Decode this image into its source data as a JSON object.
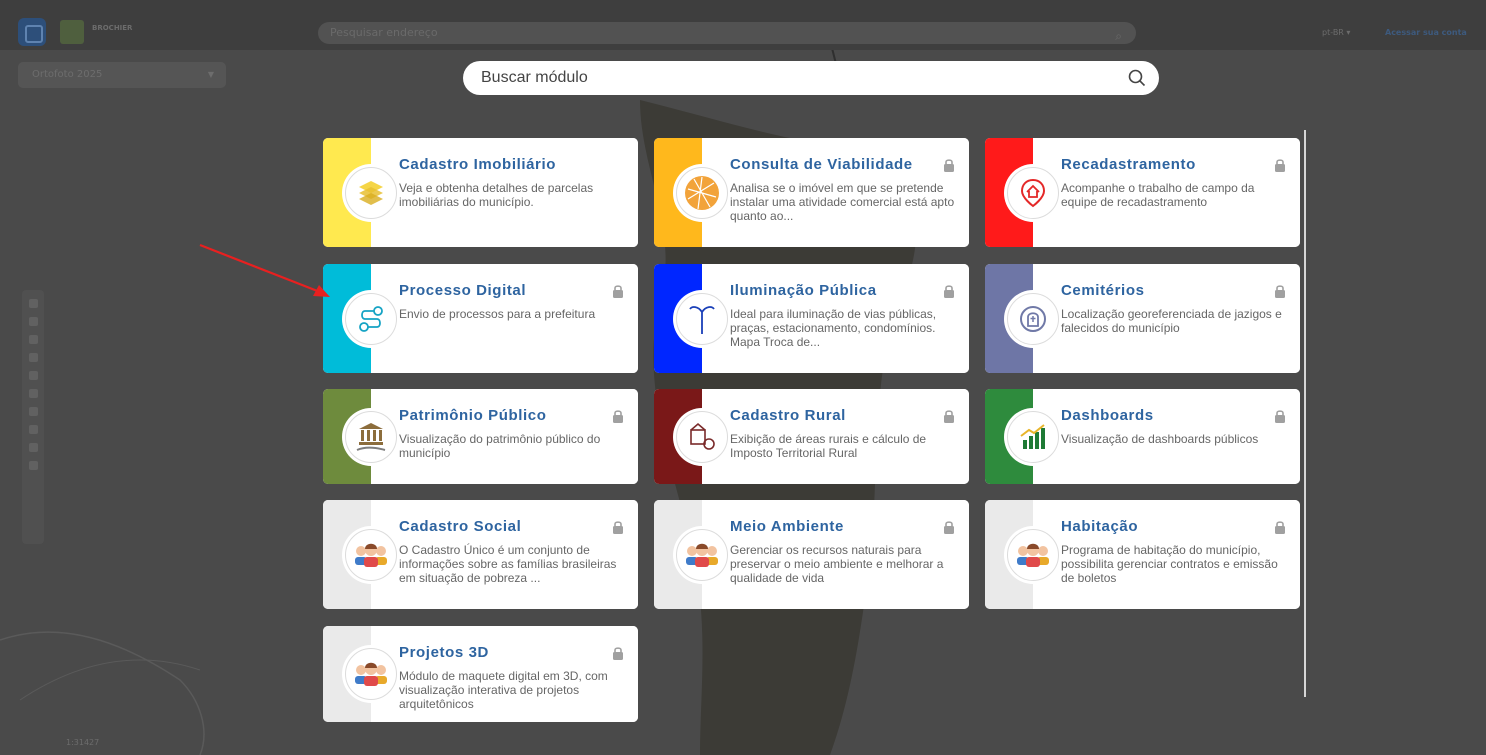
{
  "topbar": {
    "city_name": "BROCHIER",
    "search_placeholder": "Pesquisar endereço",
    "language": "pt-BR ▾",
    "login": "Acessar sua conta"
  },
  "ortho_select": {
    "value": "Ortofoto 2025"
  },
  "scale_label": "1:31427",
  "module_search": {
    "placeholder": "Buscar módulo"
  },
  "colors": {
    "yellow": "#FFE94F",
    "orange": "#FFB81C",
    "red": "#FF1A1A",
    "cyan": "#00BCD9",
    "blue": "#0026FF",
    "slate": "#6E76A6",
    "olive": "#6E8B3D",
    "maroon": "#7A1818",
    "green": "#2E8B3D",
    "grey": "#EAEAEA",
    "title_blue": "#2E64A0"
  },
  "modules": [
    {
      "id": "cadastro-imobiliario",
      "title": "Cadastro Imobiliário",
      "desc": "Veja e obtenha detalhes de parcelas imobiliárias do município.",
      "locked": false,
      "color": "#FFE94F",
      "icon": "layers-icon"
    },
    {
      "id": "consulta-viabilidade",
      "title": "Consulta de Viabilidade",
      "desc": "Analisa se o imóvel em que se pretende instalar uma atividade comercial está apto quanto ao...",
      "locked": true,
      "color": "#FFB81C",
      "icon": "map-globe-icon"
    },
    {
      "id": "recadastramento",
      "title": "Recadastramento",
      "desc": "Acompanhe o trabalho de campo da equipe de recadastramento",
      "locked": true,
      "color": "#FF1A1A",
      "icon": "house-pin-icon"
    },
    {
      "id": "processo-digital",
      "title": "Processo Digital",
      "desc": "Envio de processos para a prefeitura",
      "locked": true,
      "color": "#00BCD9",
      "icon": "workflow-icon"
    },
    {
      "id": "iluminacao-publica",
      "title": "Iluminação Pública",
      "desc": "Ideal para iluminação de vias públicas, praças, estacionamento, condomínios. Mapa Troca de...",
      "locked": true,
      "color": "#0026FF",
      "icon": "street-lamp-icon"
    },
    {
      "id": "cemiterios",
      "title": "Cemitérios",
      "desc": "Localização georeferenciada de jazigos e falecidos do município",
      "locked": true,
      "color": "#6E76A6",
      "icon": "tomb-icon"
    },
    {
      "id": "patrimonio-publico",
      "title": "Patrimônio Público",
      "desc": "Visualização do patrimônio público do município",
      "locked": true,
      "color": "#6E8B3D",
      "icon": "building-hand-icon"
    },
    {
      "id": "cadastro-rural",
      "title": "Cadastro Rural",
      "desc": "Exibição de áreas rurais e cálculo de Imposto Territorial Rural",
      "locked": true,
      "color": "#7A1818",
      "icon": "farm-icon"
    },
    {
      "id": "dashboards",
      "title": "Dashboards",
      "desc": "Visualização de dashboards públicos",
      "locked": true,
      "color": "#2E8B3D",
      "icon": "bar-chart-icon"
    },
    {
      "id": "cadastro-social",
      "title": "Cadastro Social",
      "desc": "O Cadastro Único é um conjunto de informações sobre as famílias brasileiras em situação de pobreza ...",
      "locked": true,
      "color": "#EAEAEA",
      "icon": "people-icon"
    },
    {
      "id": "meio-ambiente",
      "title": "Meio Ambiente",
      "desc": "Gerenciar os recursos naturais para preservar o meio ambiente e melhorar a qualidade de vida",
      "locked": true,
      "color": "#EAEAEA",
      "icon": "people-icon"
    },
    {
      "id": "habitacao",
      "title": "Habitação",
      "desc": "Programa de habitação do município, possibilita gerenciar contratos e emissão de boletos",
      "locked": true,
      "color": "#EAEAEA",
      "icon": "people-icon"
    },
    {
      "id": "projetos-3d",
      "title": "Projetos 3D",
      "desc": "Módulo de maquete digital em 3D, com visualização interativa de projetos arquitetônicos",
      "locked": true,
      "color": "#EAEAEA",
      "icon": "people-icon"
    }
  ]
}
